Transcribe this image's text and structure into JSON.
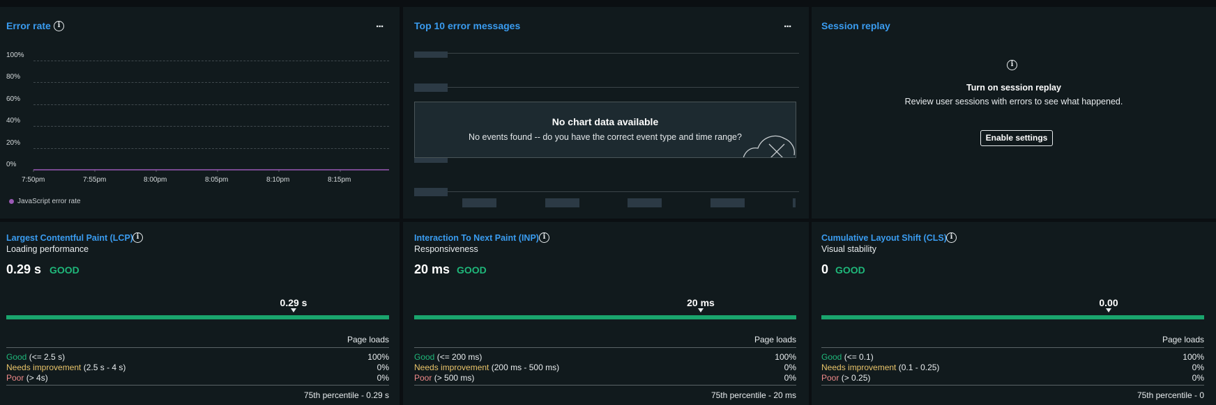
{
  "error_rate": {
    "title": "Error rate",
    "more_label": "...",
    "legend": "JavaScript error rate",
    "series_color": "#9b59b6"
  },
  "chart_data": {
    "type": "line",
    "title": "Error rate",
    "x": [
      "7:50pm",
      "7:55pm",
      "8:00pm",
      "8:05pm",
      "8:10pm",
      "8:15pm"
    ],
    "y_ticks": [
      "100%",
      "80%",
      "60%",
      "40%",
      "20%",
      "0%"
    ],
    "ylim": [
      0,
      100
    ],
    "grid": true,
    "legend_placement": "bottom-left",
    "series": [
      {
        "name": "JavaScript error rate",
        "values": [
          0,
          0,
          0,
          0,
          0,
          0
        ]
      }
    ]
  },
  "top_errors": {
    "title": "Top 10 error messages",
    "more_label": "...",
    "nodata_title": "No chart data available",
    "nodata_sub": "No events found -- do you have the correct event type and time range?"
  },
  "session_replay": {
    "title": "Session replay",
    "heading": "Turn on session replay",
    "description": "Review user sessions with errors to see what happened.",
    "button": "Enable settings"
  },
  "vitals": [
    {
      "title": "Largest Contentful Paint (LCP)",
      "subtitle": "Loading performance",
      "value": "0.29 s",
      "rating": "GOOD",
      "marker_label": "0.29 s",
      "marker_position": 0.75,
      "loads_header": "Page loads",
      "rows": [
        {
          "label": "Good",
          "range": "(<= 2.5 s)",
          "pct": "100%"
        },
        {
          "label": "Needs improvement",
          "range": "(2.5 s - 4 s)",
          "pct": "0%"
        },
        {
          "label": "Poor",
          "range": "(> 4s)",
          "pct": "0%"
        }
      ],
      "footer": "75th percentile - 0.29 s"
    },
    {
      "title": "Interaction To Next Paint (INP)",
      "subtitle": "Responsiveness",
      "value": "20 ms",
      "rating": "GOOD",
      "marker_label": "20 ms",
      "marker_position": 0.75,
      "loads_header": "Page loads",
      "rows": [
        {
          "label": "Good",
          "range": "(<= 200 ms)",
          "pct": "100%"
        },
        {
          "label": "Needs improvement",
          "range": "(200 ms - 500 ms)",
          "pct": "0%"
        },
        {
          "label": "Poor",
          "range": "(> 500 ms)",
          "pct": "0%"
        }
      ],
      "footer": "75th percentile - 20 ms"
    },
    {
      "title": "Cumulative Layout Shift (CLS)",
      "subtitle": "Visual stability",
      "value": "0",
      "rating": "GOOD",
      "marker_label": "0.00",
      "marker_position": 0.75,
      "loads_header": "Page loads",
      "rows": [
        {
          "label": "Good",
          "range": "(<= 0.1)",
          "pct": "100%"
        },
        {
          "label": "Needs improvement",
          "range": "(0.1 - 0.25)",
          "pct": "0%"
        },
        {
          "label": "Poor",
          "range": "(> 0.25)",
          "pct": "0%"
        }
      ],
      "footer": "75th percentile - 0"
    }
  ]
}
